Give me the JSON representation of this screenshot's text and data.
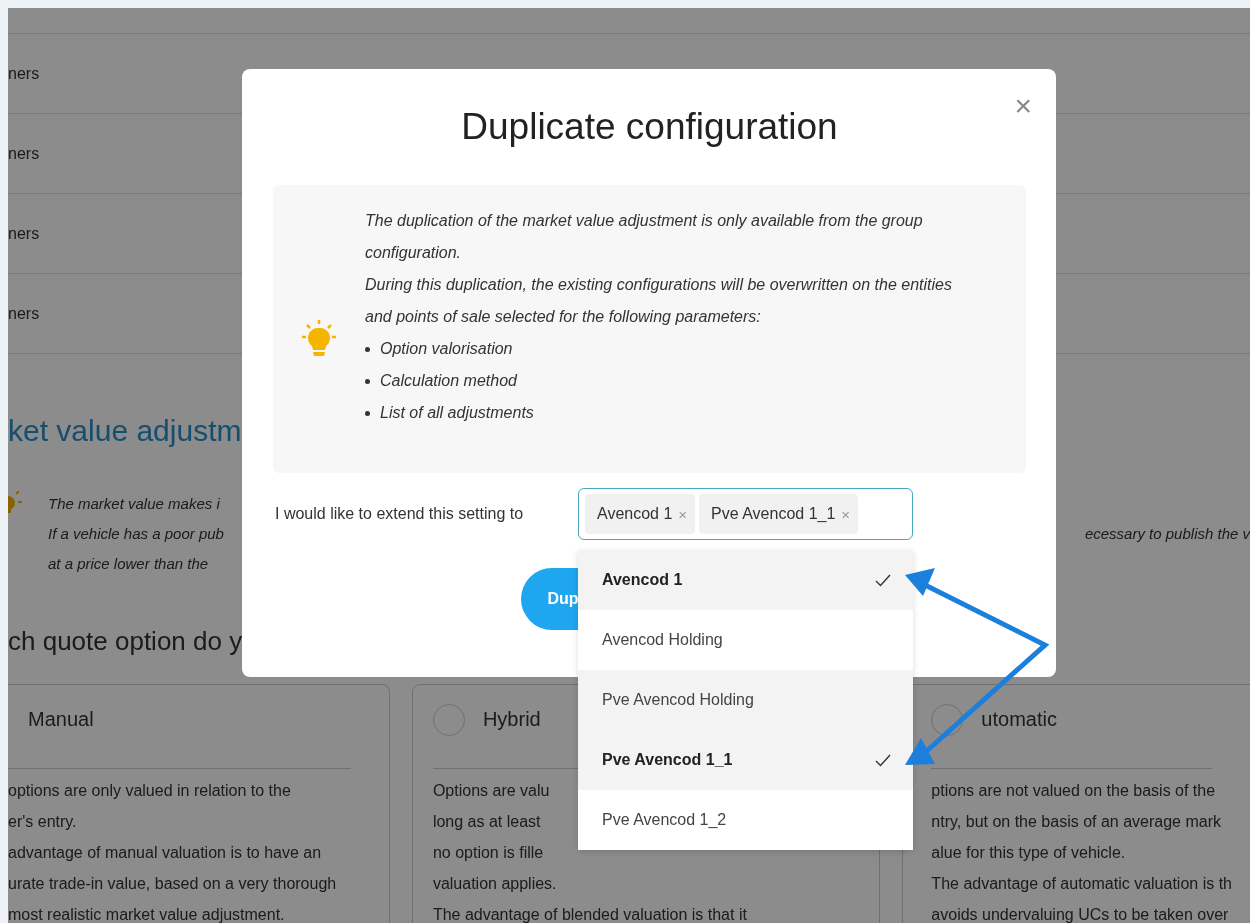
{
  "background": {
    "rows": [
      "ners",
      "ners",
      "ners",
      "ners"
    ],
    "section_title": "ket value adjustm",
    "info_lines": [
      "The market value makes i",
      "If a vehicle has a poor pub",
      "at a price lower than the"
    ],
    "info_tail": "ecessary to publish the v",
    "question": "ch quote option do y",
    "cards": [
      {
        "title": "Manual",
        "lines": [
          "options are only valued in relation to the",
          "er's entry.",
          "advantage of manual valuation is to have an",
          "urate trade-in value, based on a very thorough",
          "most realistic market value adjustment."
        ]
      },
      {
        "title": "Hybrid",
        "selected": false,
        "lines": [
          "Options are valu",
          "long as at least",
          "no option is fille",
          "valuation applies.",
          "The advantage of blended valuation is that it"
        ]
      },
      {
        "title": "utomatic",
        "selected": false,
        "lines": [
          "ptions are not valued on the basis of the",
          "ntry, but on the basis of an average mark",
          "alue for this type of vehicle.",
          "The advantage of automatic valuation is th",
          "avoids undervaluing UCs to be taken over"
        ]
      }
    ]
  },
  "modal": {
    "title": "Duplicate configuration",
    "close": "×",
    "info": {
      "paragraphs": [
        "The duplication of the market value adjustment is only available from the group configuration.",
        "During this duplication, the existing configurations will be overwritten on the entities and points of sale selected for the following parameters:"
      ],
      "bullets": [
        "Option valorisation",
        "Calculation method",
        "List of all adjustments"
      ]
    },
    "extend_label": "I would like to extend this setting to",
    "tags": [
      {
        "label": "Avencod 1",
        "remove": "×"
      },
      {
        "label": "Pve Avencod 1_1",
        "remove": "×"
      }
    ],
    "button": "Dup",
    "options": [
      {
        "label": "Avencod 1",
        "selected": true,
        "highlighted": false
      },
      {
        "label": "Avencod Holding",
        "selected": false,
        "highlighted": false
      },
      {
        "label": "Pve Avencod Holding",
        "selected": false,
        "highlighted": true
      },
      {
        "label": "Pve Avencod 1_1",
        "selected": true,
        "highlighted": false
      },
      {
        "label": "Pve Avencod 1_2",
        "selected": false,
        "highlighted": false
      }
    ]
  }
}
